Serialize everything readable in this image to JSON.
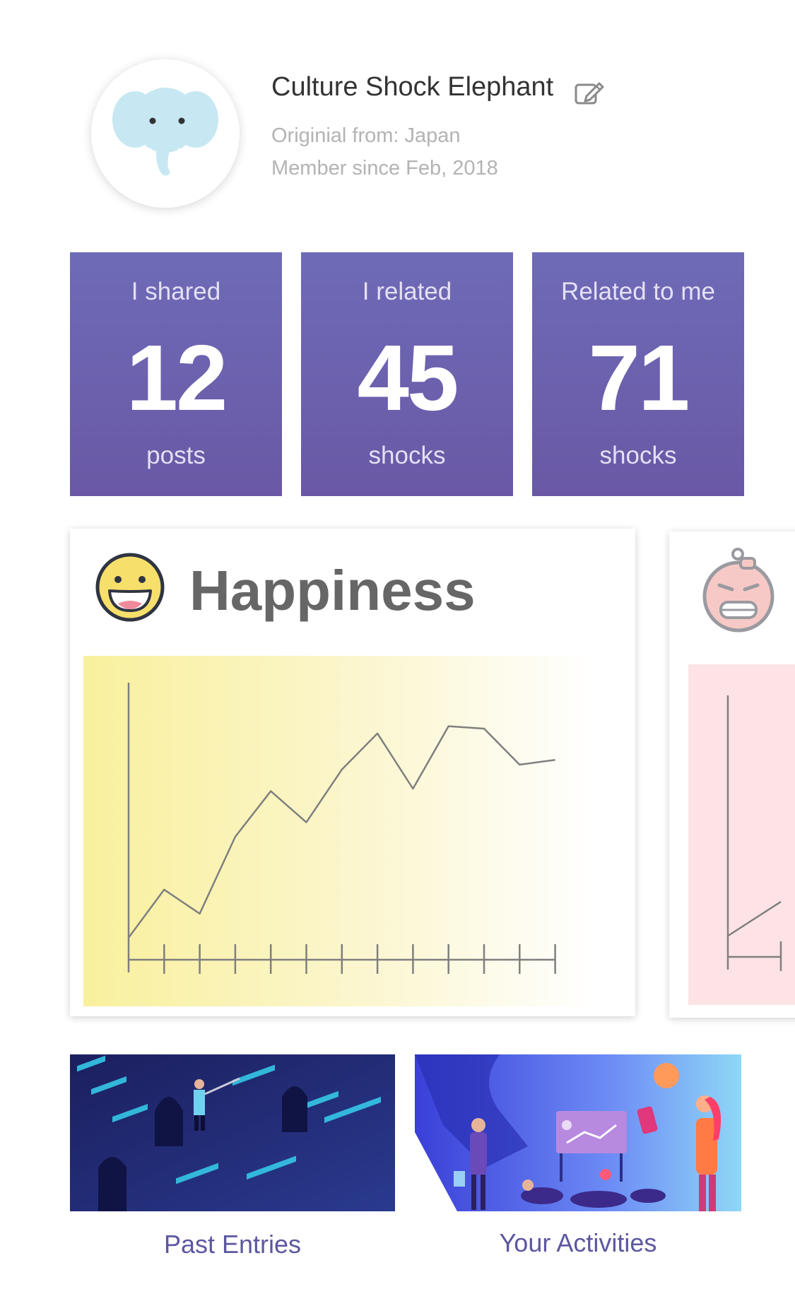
{
  "profile": {
    "name": "Culture Shock Elephant",
    "origin": "Originial from: Japan",
    "member_since": "Member since Feb, 2018",
    "avatar_icon": "elephant-icon",
    "edit_icon": "edit-icon"
  },
  "stats": [
    {
      "label": "I shared",
      "value": "12",
      "unit": "posts"
    },
    {
      "label": "I related",
      "value": "45",
      "unit": "shocks"
    },
    {
      "label": "Related to me",
      "value": "71",
      "shocks_unit": "",
      "unit": "shocks"
    }
  ],
  "mood_cards": [
    {
      "title": "Happiness",
      "icon": "happy-face-icon",
      "accent": "#f9f09d"
    },
    {
      "title": "",
      "icon": "angry-face-icon",
      "accent": "#fde3e5"
    }
  ],
  "chart_data": [
    {
      "type": "line",
      "title": "",
      "xlabel": "",
      "ylabel": "",
      "x": [
        0,
        1,
        2,
        3,
        4,
        5,
        6,
        7,
        8,
        9,
        10,
        11,
        12
      ],
      "ylim": [
        0,
        10
      ],
      "series": [
        {
          "values": [
            0.8,
            2.8,
            1.8,
            5.0,
            6.9,
            5.6,
            7.8,
            9.3,
            7.0,
            9.6,
            9.5,
            8.0,
            8.2
          ]
        }
      ]
    },
    {
      "type": "line",
      "title": "",
      "xlabel": "",
      "ylabel": "",
      "x": [
        0,
        1
      ],
      "ylim": [
        0,
        10
      ],
      "series": [
        {
          "values": [
            0.8,
            2.3
          ]
        }
      ]
    }
  ],
  "links": [
    {
      "label": "Past Entries"
    },
    {
      "label": "Your Activities"
    }
  ]
}
